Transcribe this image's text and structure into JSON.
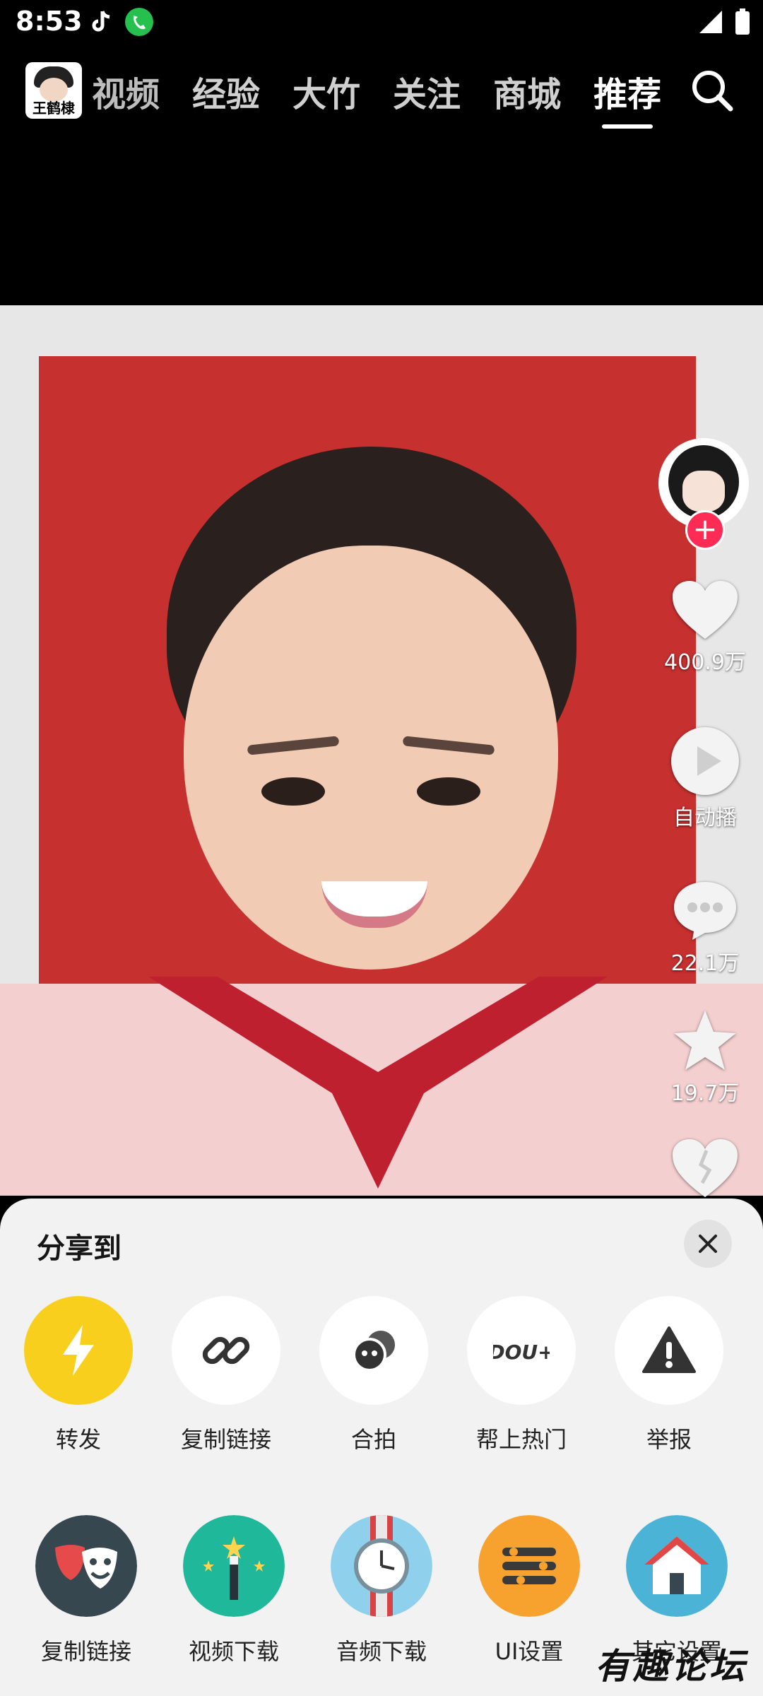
{
  "status_bar": {
    "time": "8:53"
  },
  "header": {
    "logo_text": "王鹤棣",
    "tabs": [
      {
        "label": "视频"
      },
      {
        "label": "经验"
      },
      {
        "label": "大竹"
      },
      {
        "label": "关注"
      },
      {
        "label": "商城"
      },
      {
        "label": "推荐"
      }
    ]
  },
  "actions": {
    "like_count": "400.9万",
    "autoplay_label": "自动播",
    "comment_count": "22.1万",
    "favorite_count": "19.7万"
  },
  "share_sheet": {
    "title": "分享到",
    "row1": [
      {
        "label": "转发",
        "icon": "bolt-icon"
      },
      {
        "label": "复制链接",
        "icon": "link-icon"
      },
      {
        "label": "合拍",
        "icon": "duet-icon"
      },
      {
        "label": "帮上热门",
        "icon": "dou-plus-icon"
      },
      {
        "label": "举报",
        "icon": "warning-icon"
      }
    ],
    "row2": [
      {
        "label": "复制链接",
        "icon": "theater-mask-icon"
      },
      {
        "label": "视频下载",
        "icon": "magic-wand-icon"
      },
      {
        "label": "音频下载",
        "icon": "watch-icon"
      },
      {
        "label": "UI设置",
        "icon": "menu-icon"
      },
      {
        "label": "其它设置",
        "icon": "home-icon"
      }
    ]
  },
  "watermark": "有趣论坛",
  "colors": {
    "accent_yellow": "#f8cf1c",
    "follow_red": "#fe2c55"
  }
}
